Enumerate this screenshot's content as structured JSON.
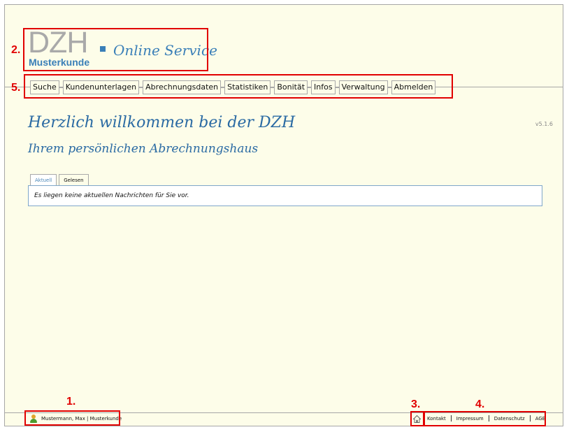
{
  "annotations": [
    "1.",
    "2.",
    "3.",
    "4.",
    "5."
  ],
  "logo": {
    "brand": "DZH",
    "service": "Online Service",
    "customer": "Musterkunde",
    "brand_color": "#a9a9a9",
    "accent_color": "#3a7fb8"
  },
  "nav": {
    "items": [
      "Suche",
      "Kundenunterlagen",
      "Abrechnungsdaten",
      "Statistiken",
      "Bonität",
      "Infos",
      "Verwaltung",
      "Abmelden"
    ]
  },
  "welcome": {
    "line1": "Herzlich willkommen bei der DZH",
    "line2": "Ihrem persönlichen Abrechnungshaus"
  },
  "version": "v5.1.6",
  "tabs": [
    {
      "label": "Aktuell",
      "active": true
    },
    {
      "label": "Gelesen",
      "active": false
    }
  ],
  "message": "Es liegen keine aktuellen Nachrichten für Sie vor.",
  "footer": {
    "user": "Mustermann, Max | Musterkunde",
    "home_icon": "home-icon",
    "links": [
      "Kontakt",
      "Impressum",
      "Datenschutz",
      "AGB"
    ]
  },
  "colors": {
    "background": "#fdfde9",
    "annotation_red": "#e10000",
    "border_gray": "#a7a7a7",
    "link_blue": "#2a6aa3"
  }
}
